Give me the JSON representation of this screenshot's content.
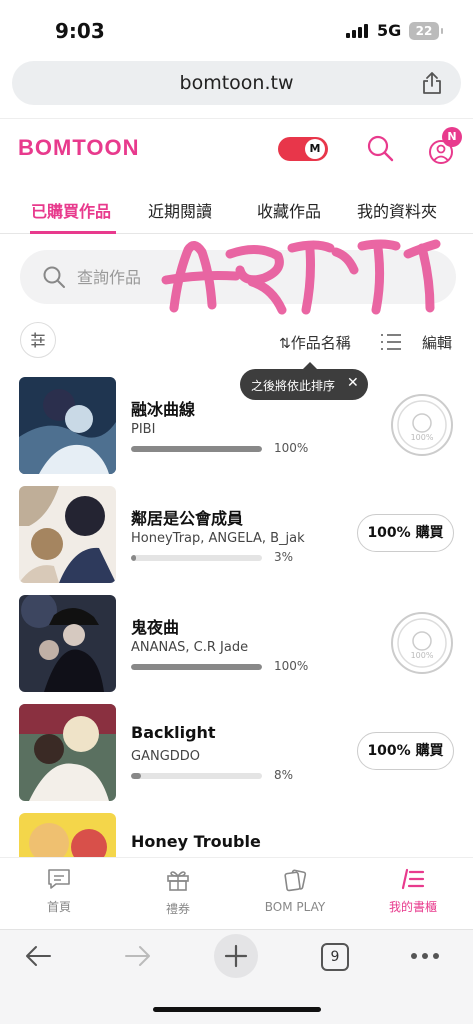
{
  "status": {
    "time": "9:03",
    "network": "5G",
    "battery": "22"
  },
  "browser": {
    "url": "bomtoon.tw",
    "tab_count": "9"
  },
  "header": {
    "logo": "BOMTOON",
    "mode_badge": "M",
    "notification_badge": "N"
  },
  "tabs": [
    {
      "label": "已購買作品",
      "active": true
    },
    {
      "label": "近期閱讀",
      "active": false
    },
    {
      "label": "收藏作品",
      "active": false
    },
    {
      "label": "我的資料夾",
      "active": false
    }
  ],
  "search": {
    "placeholder": "查詢作品"
  },
  "toolbar": {
    "sort_label": "作品名稱",
    "edit_label": "編輯",
    "tooltip": "之後將依此排序",
    "tooltip_close": "✕"
  },
  "items": [
    {
      "title": "融冰曲線",
      "author": "PIBI",
      "progress": 100,
      "progress_label": "100%",
      "action": "stamp"
    },
    {
      "title": "鄰居是公會成員",
      "author": "HoneyTrap, ANGELA, B_jak",
      "progress": 3,
      "progress_label": "3%",
      "action": "100% 購買"
    },
    {
      "title": "鬼夜曲",
      "author": "ANANAS, C.R Jade",
      "progress": 100,
      "progress_label": "100%",
      "action": "stamp"
    },
    {
      "title": "Backlight",
      "author": "GANGDDO",
      "progress": 8,
      "progress_label": "8%",
      "action": "100% 購買"
    },
    {
      "title": "Honey Trouble",
      "author": "",
      "progress": null,
      "progress_label": "",
      "action": ""
    }
  ],
  "stamp_text": "100%",
  "bottom_nav": [
    {
      "label": "首頁",
      "icon": "chat-icon",
      "active": false
    },
    {
      "label": "禮券",
      "icon": "gift-icon",
      "active": false
    },
    {
      "label": "BOM PLAY",
      "icon": "cards-icon",
      "active": false
    },
    {
      "label": "我的書櫃",
      "icon": "bookshelf-icon",
      "active": true
    }
  ],
  "colors": {
    "brand": "#e83a8d",
    "toggle": "#e8364a"
  }
}
